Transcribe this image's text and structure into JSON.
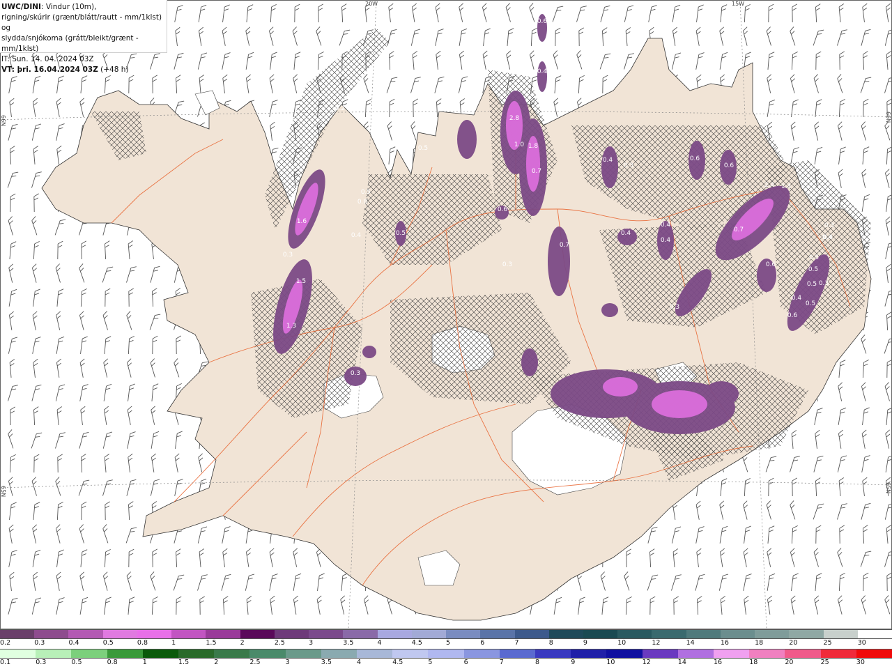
{
  "header": {
    "model": "UWC/DINI",
    "line1": ": Vindur (10m),",
    "line2": "rigning/skúrir (grænt/blátt/rautt - mm/1klst) og",
    "line3": "slydda/snjókoma (grátt/bleikt/grænt - mm/1klst)",
    "line4": "IT: Sun. 14. 04. 2024 03Z",
    "vt_label": "VT: þri. 16.04.2024 03Z",
    "vt_suffix": " (+48 h)"
  },
  "graticule": {
    "lon_20w": "20W",
    "lon_15w": "15W",
    "lat_66n_left": "66N",
    "lat_66n_right": "66N",
    "lat_65n_left": "65N",
    "lat_65n_right": "65N"
  },
  "snow_legend": {
    "labels": [
      "0.2",
      "0.3",
      "0.4",
      "0.5",
      "0.8",
      "1",
      "1.5",
      "2",
      "2.5",
      "3",
      "3.5",
      "4",
      "4.5",
      "5",
      "6",
      "7",
      "8",
      "9",
      "10",
      "12",
      "14",
      "16",
      "18",
      "20",
      "25",
      "30"
    ],
    "colors": [
      "#6a3f6a",
      "#8e4c8e",
      "#b35ab3",
      "#e07ae0",
      "#e86fe8",
      "#c254c2",
      "#9a3a9a",
      "#5a0a5a",
      "#6e3a7a",
      "#7b4a8c",
      "#8a6aa8",
      "#a8a8e0",
      "#a2aad6",
      "#7a8cc0",
      "#5a74a8",
      "#3d5a8c",
      "#1f4a5a",
      "#1a4a52",
      "#2a5a60",
      "#3a6a6e",
      "#4f7a7c",
      "#6b8e8e",
      "#7f9c9a",
      "#8fa8a4",
      "#c8d0cc",
      "#ffffff"
    ]
  },
  "rain_legend": {
    "labels": [
      "0.1",
      "0.3",
      "0.5",
      "0.8",
      "1",
      "1.5",
      "2",
      "2.5",
      "3",
      "3.5",
      "4",
      "4.5",
      "5",
      "6",
      "7",
      "8",
      "9",
      "10",
      "12",
      "14",
      "16",
      "18",
      "20",
      "25",
      "30"
    ],
    "colors": [
      "#e0ffe0",
      "#b8f0b8",
      "#7cd07c",
      "#3a9a3a",
      "#0a5a0a",
      "#2a6a2a",
      "#3a7a4a",
      "#4a8a6a",
      "#6a9a8a",
      "#8aaab0",
      "#a8b8d8",
      "#c0c8f0",
      "#b0b8f0",
      "#8a96e0",
      "#5a6ad0",
      "#3a3ac0",
      "#2020a8",
      "#1010a0",
      "#6a3ac0",
      "#b070e0",
      "#f0a0f0",
      "#f080c0",
      "#f05a8a",
      "#f02a3a",
      "#f00a0a"
    ]
  },
  "map": {
    "land_color": "#f1e4d6",
    "road_color": "#e8602a",
    "snow_label_values": [
      "0.6",
      "0.4",
      "0.2",
      "2.8",
      "1.0",
      "1.8",
      "0.7",
      "0.5",
      "0.8",
      "0.4",
      "0.3",
      "0.6",
      "0.6",
      "0.5",
      "0.6",
      "1.6",
      "0.3",
      "1.5",
      "1.3",
      "0.4",
      "0.3",
      "0.5",
      "0.4",
      "0.3",
      "0.4",
      "0.6",
      "0.4",
      "0.7",
      "0.3",
      "0.5",
      "0.5",
      "0.4",
      "0.6",
      "0.5",
      "0.3",
      "0.4",
      "0.3",
      "0.4",
      "0.5",
      "1.4",
      "2.4",
      "0.7"
    ]
  }
}
